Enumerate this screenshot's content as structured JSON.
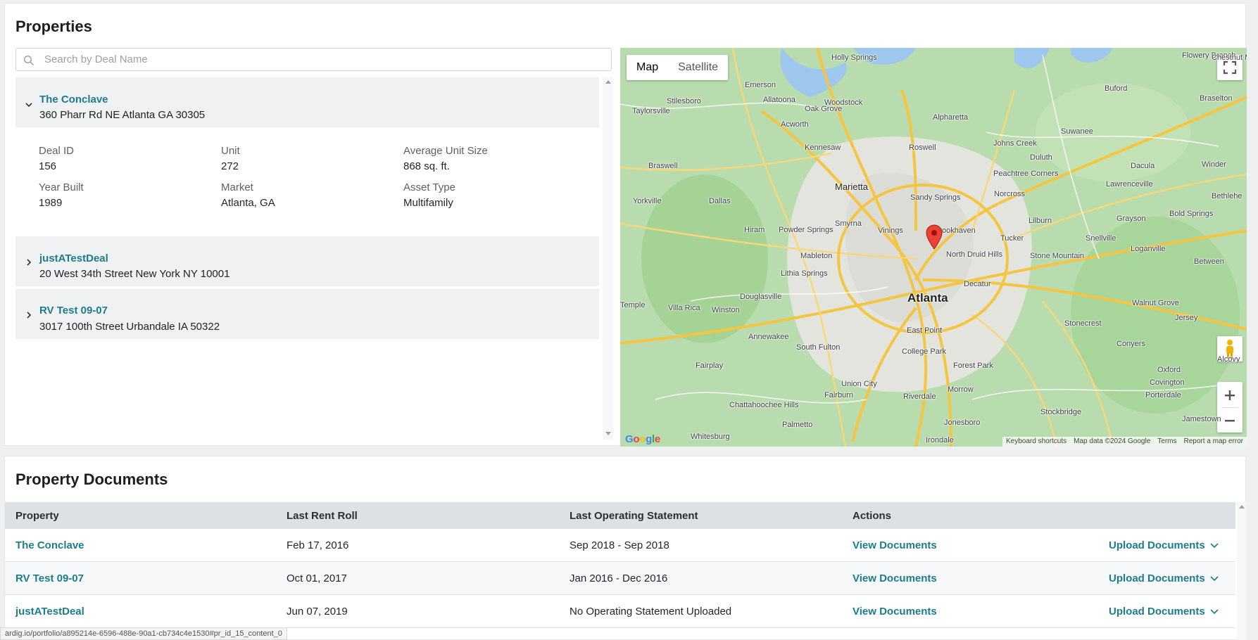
{
  "properties": {
    "title": "Properties",
    "search_placeholder": "Search by Deal Name",
    "items": [
      {
        "name": "The Conclave",
        "address": "360 Pharr Rd NE Atlanta GA 30305",
        "expanded": true,
        "details": [
          {
            "label": "Deal ID",
            "value": "156"
          },
          {
            "label": "Unit",
            "value": "272"
          },
          {
            "label": "Average Unit Size",
            "value": "868 sq. ft."
          },
          {
            "label": "Year Built",
            "value": "1989"
          },
          {
            "label": "Market",
            "value": "Atlanta, GA"
          },
          {
            "label": "Asset Type",
            "value": "Multifamily"
          }
        ]
      },
      {
        "name": "justATestDeal",
        "address": "20 West 34th Street New York NY 10001",
        "expanded": false
      },
      {
        "name": "RV Test 09-07",
        "address": "3017 100th Street Urbandale IA 50322",
        "expanded": false
      }
    ]
  },
  "map": {
    "type_buttons": {
      "map": "Map",
      "satellite": "Satellite"
    },
    "active_type": "Map",
    "labels": {
      "city_main": "Atlanta",
      "marietta": "Marietta",
      "holly_springs": "Holly Springs",
      "flowery_branch": "Flowery Branch",
      "chestnut_mountain": "Chestnut Mountain",
      "emerson": "Emerson",
      "stilesboro": "Stilesboro",
      "taylorsville": "Taylorsville",
      "allatoona": "Allatoona",
      "oak_grove": "Oak Grove",
      "woodstock": "Woodstock",
      "alpharetta": "Alpharetta",
      "buford": "Buford",
      "braselton": "Braselton",
      "acworth": "Acworth",
      "kennesaw": "Kennesaw",
      "roswell": "Roswell",
      "johns_creek": "Johns Creek",
      "suwanee": "Suwanee",
      "duluth": "Duluth",
      "braswell": "Braswell",
      "peachtree_corners": "Peachtree Corners",
      "dacula": "Dacula",
      "sandy_springs": "Sandy Springs",
      "norcross": "Norcross",
      "lawrenceville": "Lawrenceville",
      "yorkville": "Yorkville",
      "dallas": "Dallas",
      "smyrna": "Smyrna",
      "lilburn": "Lilburn",
      "grayson": "Grayson",
      "bold_springs": "Bold Springs",
      "hiram": "Hiram",
      "powder_springs": "Powder Springs",
      "vinings": "Vinings",
      "brookhaven": "Brookhaven",
      "tucker": "Tucker",
      "snellville": "Snellville",
      "mableton": "Mableton",
      "north_druid_hills": "North Druid Hills",
      "stone_mountain": "Stone Mountain",
      "loganville": "Loganville",
      "between": "Between",
      "lithia_springs": "Lithia Springs",
      "decatur": "Decatur",
      "douglasville": "Douglasville",
      "villa_rica": "Villa Rica",
      "winston": "Winston",
      "temple": "Temple",
      "walnut_grove": "Walnut Grove",
      "jersey": "Jersey",
      "east_point": "East Point",
      "annewakee": "Annewakee",
      "south_fulton": "South Fulton",
      "college_park": "College Park",
      "stonecrest": "Stonecrest",
      "conyers": "Conyers",
      "alcovy": "Alcovy",
      "fairplay": "Fairplay",
      "forest_park": "Forest Park",
      "oxford": "Oxford",
      "covington": "Covington",
      "union_city": "Union City",
      "morrow": "Morrow",
      "porterdale": "Porterdale",
      "fairburn": "Fairburn",
      "riverdale": "Riverdale",
      "chattahoochee_hills": "Chattahoochee Hills",
      "stockbridge": "Stockbridge",
      "jamestown": "Jamestown",
      "palmetto": "Palmetto",
      "jonesboro": "Jonesboro",
      "whitesburg": "Whitesburg",
      "bethlehem": "Bethlehe",
      "winder": "Winder",
      "irondale": "Irondale"
    },
    "attribution": [
      "Keyboard shortcuts",
      "Map data ©2024 Google",
      "Terms",
      "Report a map error"
    ],
    "logo": "Google",
    "pin_color": "#ea4335"
  },
  "documents": {
    "title": "Property Documents",
    "headers": {
      "property": "Property",
      "rent_roll": "Last Rent Roll",
      "operating": "Last Operating Statement",
      "actions": "Actions"
    },
    "rows": [
      {
        "property": "The Conclave",
        "rent_roll": "Feb 17, 2016",
        "operating": "Sep 2018 - Sep 2018",
        "view": "View Documents",
        "upload": "Upload Documents"
      },
      {
        "property": "RV Test 09-07",
        "rent_roll": "Oct 01, 2017",
        "operating": "Jan 2016 - Dec 2016",
        "view": "View Documents",
        "upload": "Upload Documents"
      },
      {
        "property": "justATestDeal",
        "rent_roll": "Jun 07, 2019",
        "operating": "No Operating Statement Uploaded",
        "view": "View Documents",
        "upload": "Upload Documents"
      }
    ]
  },
  "status_bar_url": "ardig.io/portfolio/a895214e-6596-488e-90a1-cb734c4e1530#pr_id_15_content_0",
  "colors": {
    "link": "#1d7c8c",
    "header_bg": "#dde1e5",
    "item_bg": "#eff1f3"
  }
}
